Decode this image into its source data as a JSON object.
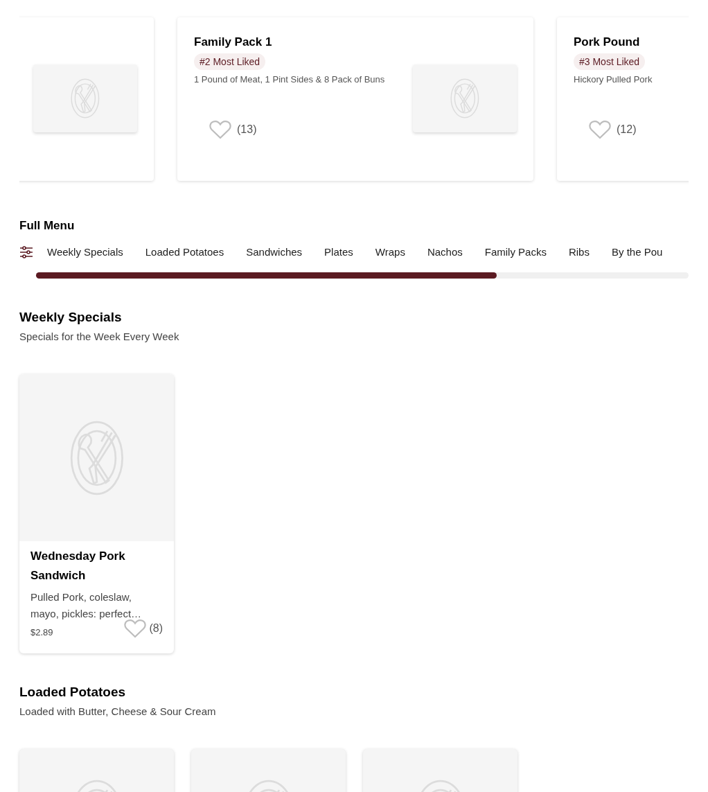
{
  "featured": [
    {
      "kind": "clipped"
    },
    {
      "kind": "full",
      "title": "Family Pack 1",
      "badge": "#2 Most Liked",
      "description": "1 Pound of Meat, 1 Pint Sides & 8 Pack of Buns",
      "likes": "(13)"
    },
    {
      "kind": "clipped_right",
      "title": "Pork Pound",
      "badge": "#3 Most Liked",
      "description": "Hickory Pulled Pork",
      "likes": "(12)"
    }
  ],
  "full_menu": {
    "title": "Full Menu",
    "tabs": [
      "Weekly Specials",
      "Loaded Potatoes",
      "Sandwiches",
      "Plates",
      "Wraps",
      "Nachos",
      "Family Packs",
      "Ribs",
      "By the Pou"
    ]
  },
  "sections": [
    {
      "title": "Weekly Specials",
      "subtitle": "Specials for the Week Every Week",
      "items": [
        {
          "kind": "full",
          "name": "Wednesday Pork Sandwich",
          "description": "Pulled Pork, coleslaw, mayo, pickles: perfect…",
          "price": "$2.89",
          "likes": "(8)"
        }
      ]
    },
    {
      "title": "Loaded Potatoes",
      "subtitle": "Loaded with Butter, Cheese & Sour Cream"
    }
  ]
}
